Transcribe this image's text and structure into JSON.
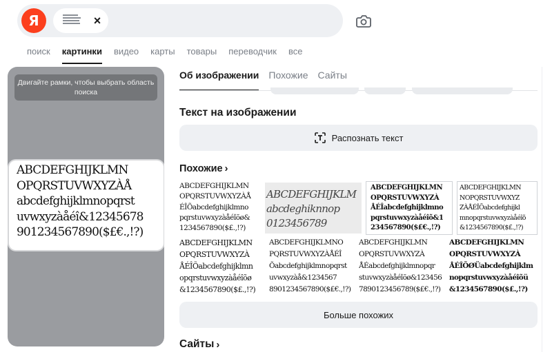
{
  "search": {
    "logo": "Я",
    "clear": "×"
  },
  "nav": {
    "items": [
      "поиск",
      "картинки",
      "видео",
      "карты",
      "товары",
      "переводчик",
      "все"
    ],
    "active": "картинки"
  },
  "preview": {
    "hint": "Двигайте рамки, чтобы выбрать область поиска",
    "selection_text": "ABCDEFGHIJKLMN\nOPQRSTUVWXYZÀÅ\nabcdefghijklmnopqrst\nuvwxyzàåéî&12345678\n901234567890($£€.,!?)"
  },
  "tabs": {
    "items": [
      "Об изображении",
      "Похожие",
      "Сайты"
    ],
    "active": "Об изображении"
  },
  "text_section": {
    "title": "Текст на изображении",
    "button": "Распознать текст"
  },
  "similar": {
    "title": "Похожие",
    "images": [
      "ABCDEFGHIJKLMN\nOPQRSTUVWXYZÀÅ\nÉÎÕabcdefghijklmno\npqrstuvwxyzàåéîõø&\n1234567890($£.,!?)",
      "ABCDEFGHIJKLM\nabcdeghiknnop\n0123456789",
      "ABCDEFGHIJKLMN\nOPQRSTUVWXYZÀ\nÅÉÎabcdefghijklmno\npqrstuvwxyzàåéîõ&1\n234567890($£€.,!?)",
      "ABCDEFGHIJKLMN\nNOPQRSTUVWXYZ\nZÀÅÉÎÕabcdefghijkl\nmnopqrstuvwxyzàåéîõ\n&1234567890($£.,!?)",
      "ABCDEFGHIJKLMN\nOPQRSTUVWXYZÀ\nÅÉÎÕabcdefghijklmn\nopqrstuvwxyzàåéîõø\n&1234567890($£.,!?)",
      "ABCDEFGHIJKLMNO\nPQRSTUVWXYZÀÅÉÎ\nÕabcdefghijklmnopqrst\nuvwxyzàå&1234567\n8901234567890($£€.,!?)",
      "ABCDEFGHIJKLMN\nOPQRSTUVWXYZÀ\nÅÉabcdefghijklmnopqr\nstuvwxyzàåéîõø&123456\n7890123456789($£€.,!?)",
      "ABCDEFGHIJKLMN\nOPQRSTUVWXYZÀ\nÅÉÎÕØÜabcdefghijklm\nnopqrstuvwxyzàåéîõü\n&1234567890($£.,!?)"
    ],
    "more_button": "Больше похожих"
  },
  "sites": {
    "title": "Сайты"
  },
  "colors": {
    "logo": "#fc3f1d",
    "panel": "#9a9ca0",
    "surface": "#eef0f3"
  }
}
